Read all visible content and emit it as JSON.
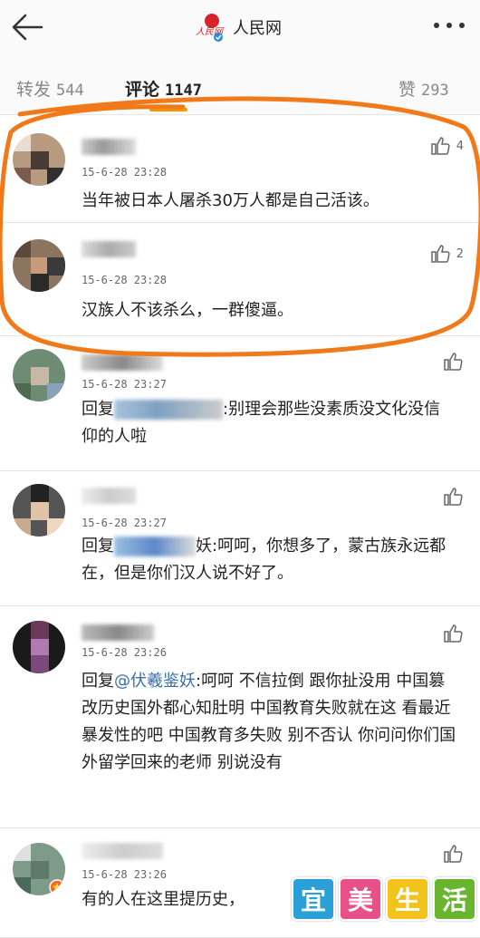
{
  "header": {
    "back_icon": "arrow-left-icon",
    "brand_name": "人民网",
    "brand_logo_text": "人民网",
    "more_icon": "more-dots-icon"
  },
  "tabs": [
    {
      "label": "转发",
      "count": "544"
    },
    {
      "label": "评论",
      "count": "1147"
    },
    {
      "label": "赞",
      "count": "293"
    }
  ],
  "comments": [
    {
      "timestamp": "15-6-28 23:28",
      "text": "当年被日本人屠杀30万人都是自己活该。",
      "likes": "4"
    },
    {
      "timestamp": "15-6-28 23:28",
      "text": "汉族人不该杀么，一群傻逼。",
      "likes": "2"
    },
    {
      "timestamp": "15-6-28 23:27",
      "reply_prefix": "回复",
      "text_after": ":别理会那些没素质没文化没信仰的人啦",
      "likes": ""
    },
    {
      "timestamp": "15-6-28 23:27",
      "reply_prefix": "回复",
      "text_after": "妖:呵呵，你想多了，蒙古族永远都在，但是你们汉人说不好了。",
      "likes": ""
    },
    {
      "timestamp": "15-6-28 23:26",
      "reply_prefix": "回复",
      "mention": "@伏羲鉴妖",
      "text_after": ":呵呵 不信拉倒 跟你扯没用 中国篡改历史国外都心知肚明 中国教育失败就在这 看最近暴发性的吧 中国教育多失败 别不否认 你问问你们国外留学回来的老师 别说没有",
      "likes": ""
    },
    {
      "timestamp": "15-6-28 23:26",
      "text": "有的人在这里提历史，",
      "likes": ""
    }
  ],
  "watermark": [
    "宜",
    "美",
    "生",
    "活"
  ],
  "colors": {
    "accent": "#f39800",
    "circle": "#f07a1a",
    "mention": "#3b6ea8",
    "wm_blue": "#2a9fd8",
    "wm_pink": "#e8508a",
    "wm_yellow": "#f2c31a",
    "wm_green": "#6ab52e"
  }
}
